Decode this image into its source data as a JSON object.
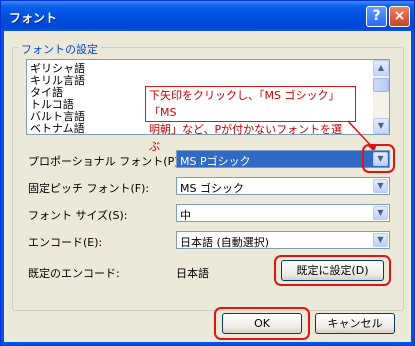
{
  "window": {
    "title": "フォント",
    "help_glyph": "?",
    "close_glyph": "×"
  },
  "group": {
    "legend": "フォントの設定"
  },
  "font_list": {
    "items": [
      "ギリシャ語",
      "キリル言語",
      "タイ語",
      "トルコ語",
      "バルト言語",
      "ベトナム語"
    ]
  },
  "annotation": {
    "line1": "下矢印をクリックし、「MS ゴシック」「MS",
    "line2": "明朝」など、Pが付かないフォントを選ぶ"
  },
  "fields": {
    "proportional": {
      "label": "プロポーショナル フォント(P):",
      "value": "MS Pゴシック"
    },
    "fixed": {
      "label": "固定ピッチ フォント(F):",
      "value": "MS ゴシック"
    },
    "size": {
      "label": "フォント サイズ(S):",
      "value": "中"
    },
    "encoding": {
      "label": "エンコード(E):",
      "value": "日本語 (自動選択)"
    },
    "default_encoding": {
      "label": "既定のエンコード:",
      "value": "日本語"
    }
  },
  "buttons": {
    "set_default": "既定に設定(D)",
    "ok": "OK",
    "cancel": "キャンセル"
  },
  "colors": {
    "title_bar": "#0054e3",
    "annotation_red": "#e01414",
    "selected": "#316ac5"
  }
}
